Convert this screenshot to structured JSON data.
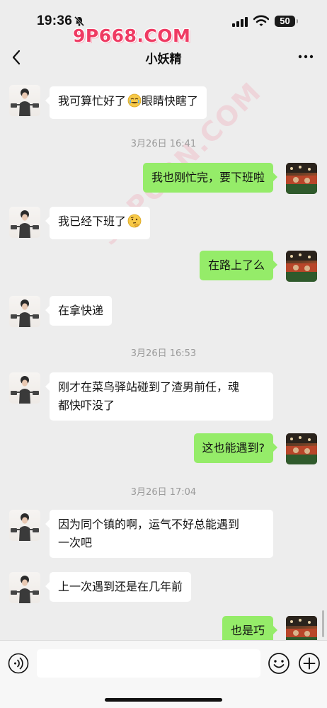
{
  "status_bar": {
    "time": "19:36",
    "battery": "50",
    "watermark_logo": "9P668.COM",
    "icons": [
      "bell-slash-icon",
      "signal-icon",
      "wifi-icon",
      "battery-icon"
    ]
  },
  "nav": {
    "title": "小妖精",
    "icons": [
      "chevron-left-icon",
      "more-dots-icon"
    ]
  },
  "watermark_diagonal": "91PORN.COM",
  "messages": [
    {
      "side": "left",
      "text": "我可算忙好了",
      "emoji": "tearful-smile-emoji",
      "text_after": "眼睛快瞎了"
    },
    {
      "type": "time",
      "text": "3月26日 16:41"
    },
    {
      "side": "right",
      "text": "我也刚忙完，要下班啦"
    },
    {
      "side": "left",
      "text": "我已经下班了",
      "emoji": "thinking-emoji"
    },
    {
      "side": "right",
      "text": "在路上了么"
    },
    {
      "side": "left",
      "text": "在拿快递"
    },
    {
      "type": "time",
      "text": "3月26日 16:53"
    },
    {
      "side": "left",
      "lines": [
        "刚才在菜鸟驿站碰到了渣男前任，魂",
        "都快吓没了"
      ]
    },
    {
      "side": "right",
      "text": "这也能遇到?"
    },
    {
      "type": "time",
      "text": "3月26日 17:04"
    },
    {
      "side": "left",
      "lines": [
        "因为同个镇的啊，运气不好总能遇到",
        "一次吧"
      ]
    },
    {
      "side": "left",
      "text": "上一次遇到还是在几年前"
    },
    {
      "side": "right",
      "text": "也是巧"
    }
  ],
  "input_bar": {
    "value": "",
    "icons": [
      "voice-icon",
      "emoji-smile-icon",
      "plus-circle-icon"
    ]
  },
  "colors": {
    "background": "#ededed",
    "bubble_self": "#95ec69",
    "bubble_other": "#ffffff",
    "timestamp": "#9a9a9a",
    "watermark": "#ef3b63"
  }
}
